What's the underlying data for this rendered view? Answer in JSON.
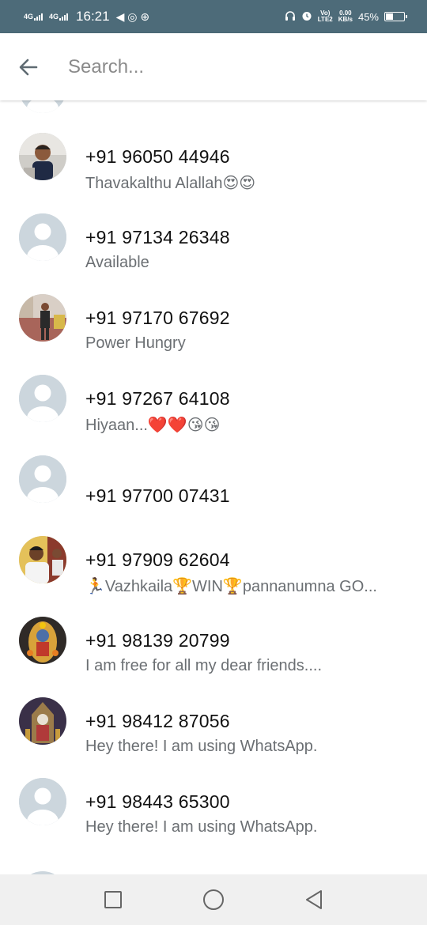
{
  "status_bar": {
    "net1": "4G",
    "net2": "4G",
    "time": "16:21",
    "app_icons": "◀ ◎ ⊕",
    "volte_top": "Vo)",
    "volte_bottom": "LTE2",
    "speed_top": "0.00",
    "speed_bottom": "KB/s",
    "battery": "45%",
    "battery_level": 0.45
  },
  "search": {
    "placeholder": "Search..."
  },
  "contacts": [
    {
      "name": "+91 96050 44946",
      "status": "Thavakalthu Alallah😍😍",
      "avatar": "photo-boy"
    },
    {
      "name": "+91 97134 26348",
      "status": "Available",
      "avatar": "default"
    },
    {
      "name": "+91 97170 67692",
      "status": "Power Hungry",
      "avatar": "photo-man-standing"
    },
    {
      "name": "+91 97267 64108",
      "status": "Hiyaan...❤️❤️😘😘",
      "avatar": "default"
    },
    {
      "name": "+91 97700 07431",
      "status": "",
      "avatar": "default"
    },
    {
      "name": "+91 97909 62604",
      "status": "🏃Vazhkaila🏆WIN🏆pannanumna GO...",
      "avatar": "photo-man-event"
    },
    {
      "name": "+91 98139 20799",
      "status": "I am free for all my dear friends....",
      "avatar": "photo-deity"
    },
    {
      "name": "+91 98412 87056",
      "status": "Hey there! I am using WhatsApp.",
      "avatar": "photo-temple"
    },
    {
      "name": "+91 98443 65300",
      "status": "Hey there! I am using WhatsApp.",
      "avatar": "default"
    }
  ],
  "colors": {
    "status_bar": "#4d6b79",
    "avatar_default_bg": "#ccd6dd",
    "status_text": "#6b6f73"
  }
}
